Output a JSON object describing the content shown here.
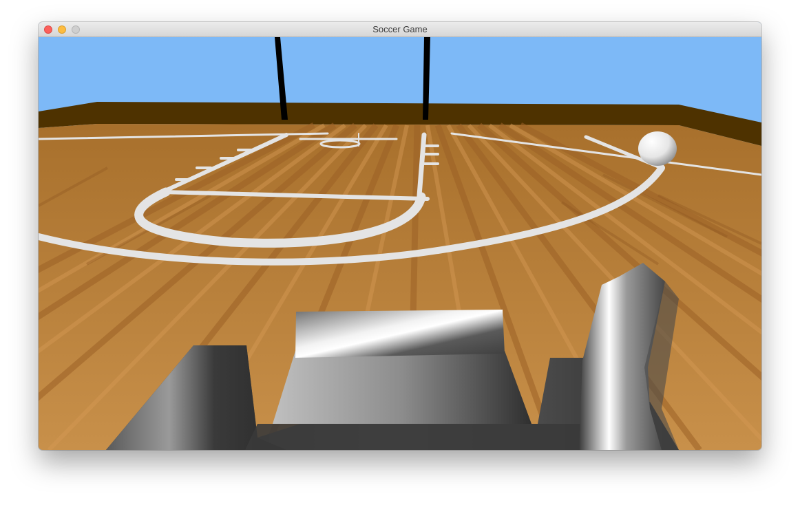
{
  "window": {
    "title": "Soccer Game"
  },
  "scene": {
    "sky_color": "#7db9f7",
    "wall_color": "#4e3200",
    "floor_color": "#c48944",
    "line_color": "#e4e4e4",
    "post_color": "#000000",
    "ball_color": "#ffffff",
    "player_color": "#8a8a8a"
  }
}
